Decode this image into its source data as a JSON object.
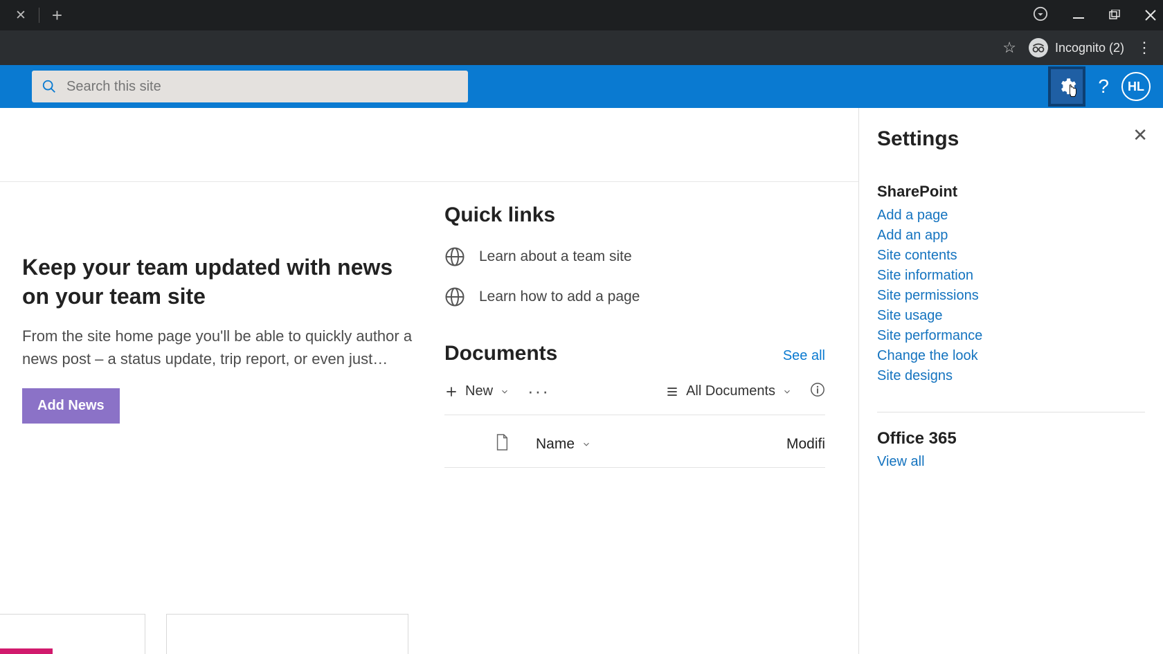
{
  "browser": {
    "incognito_label": "Incognito (2)"
  },
  "search": {
    "placeholder": "Search this site"
  },
  "avatar": {
    "initials": "HL"
  },
  "news": {
    "title": "Keep your team updated with news on your team site",
    "desc": "From the site home page you'll be able to quickly author a news post – a status update, trip report, or even just…",
    "add_btn": "Add News"
  },
  "quicklinks": {
    "heading": "Quick links",
    "items": [
      {
        "label": "Learn about a team site"
      },
      {
        "label": "Learn how to add a page"
      }
    ]
  },
  "documents": {
    "heading": "Documents",
    "see_all": "See all",
    "new_btn": "New",
    "view_label": "All Documents",
    "col_name": "Name",
    "col_modified": "Modifi"
  },
  "settings": {
    "title": "Settings",
    "sharepoint_heading": "SharePoint",
    "links": [
      "Add a page",
      "Add an app",
      "Site contents",
      "Site information",
      "Site permissions",
      "Site usage",
      "Site performance",
      "Change the look",
      "Site designs"
    ],
    "office365_heading": "Office 365",
    "view_all": "View all"
  }
}
